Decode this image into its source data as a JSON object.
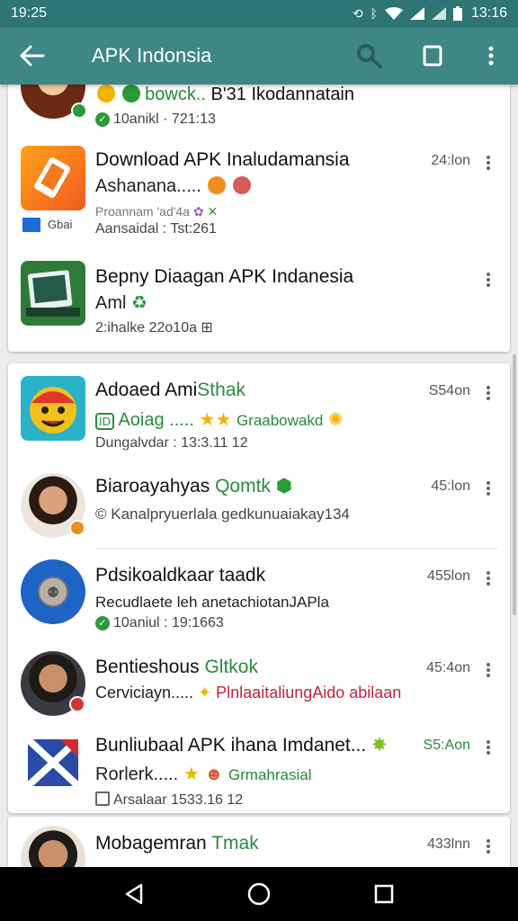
{
  "status": {
    "time_left": "19:25",
    "time_right": "13:16"
  },
  "appbar": {
    "title": "APK Indonsia"
  },
  "icons": {
    "back": "back-arrow-icon",
    "search": "search-icon",
    "window": "window-icon",
    "more": "more-vert-icon",
    "nav_back": "nav-back-icon",
    "nav_home": "nav-home-icon",
    "nav_recents": "nav-recents-icon"
  },
  "colors": {
    "status_bar": "#2e7575",
    "app_bar": "#3e8784",
    "accent_green": "#2a8a3a",
    "accent_red": "#c2243c",
    "background": "#ececec"
  },
  "items": [
    {
      "line1_a": "bowck..",
      "line1_b": "Bʹ31 Ikodannatain",
      "line3": "10anikl · 721:13"
    },
    {
      "title": "Download APK Inaludamansia",
      "line2": "Ashanana.....",
      "line3a": "Proannam ʹadʹ4a",
      "line3b": "Aansaidal : Tst:261",
      "badge_text": "Gbai",
      "time": "24:lon"
    },
    {
      "title": "Bepny Diaagan APK Indanesia",
      "line2": "Aml",
      "line3": "2:ihalke  22o10a  ⊞",
      "time": ""
    },
    {
      "title_a": "Adoaed Ami",
      "title_b": "Sthak",
      "line2_a": "Aoiag .....",
      "line2_b": "Graabowakd",
      "line3": "Dungalvdar : 13:3.11 12",
      "time": "S54on"
    },
    {
      "title_a": "Biaroayahyas",
      "title_b": "Qomtk",
      "line2": "Kanalpryuerlala gedkunuaiakay134",
      "time": "45:lon"
    },
    {
      "title": "Pdsikoaldkaar taadk",
      "line2": "Recudlaete leh anetachiotanJAPla",
      "line3": "10aniul : 19:1663",
      "time": "455lon"
    },
    {
      "title_a": "Bentieshous",
      "title_b": "Gltkok",
      "line2_a": "Cerviciayn.....",
      "line2_b": "PlnlaaitaliungAido abilaan",
      "time": "45:4on"
    },
    {
      "title": "Bunliubaal APK ihana Imdanet...",
      "line2_a": "Rorlerk.....",
      "line2_b": "Grmahrasial",
      "line3": "Arsalaar 1533.16 12",
      "time": "S5:Aon"
    },
    {
      "title_a": "Mobagemran",
      "title_b": "Tmak",
      "time": "433lnn"
    }
  ]
}
